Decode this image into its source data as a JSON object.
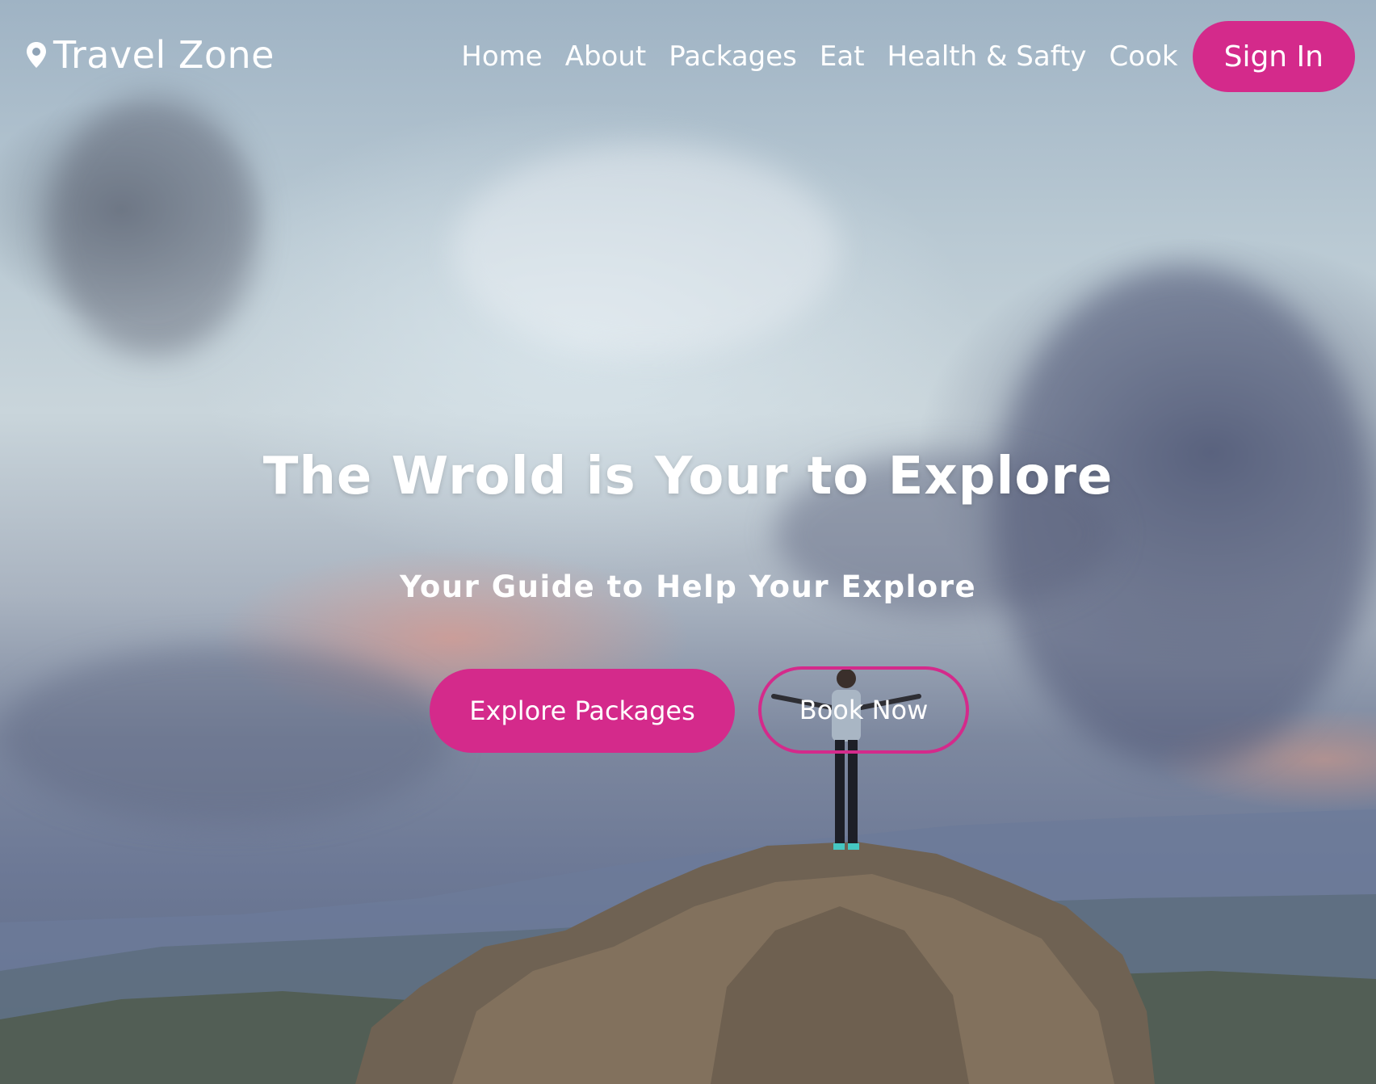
{
  "brand": {
    "name": "Travel Zone",
    "icon": "map-pin-icon"
  },
  "nav": {
    "items": [
      {
        "label": "Home"
      },
      {
        "label": "About"
      },
      {
        "label": "Packages"
      },
      {
        "label": "Eat"
      },
      {
        "label": "Health & Safty"
      },
      {
        "label": "Cook"
      }
    ],
    "signin_label": "Sign In"
  },
  "hero": {
    "headline": "The Wrold is Your to Explore",
    "subheadline": "Your Guide to Help Your Explore",
    "primary_button": "Explore Packages",
    "secondary_button": "Book Now"
  },
  "colors": {
    "accent": "#d42a8b",
    "text": "#ffffff"
  }
}
